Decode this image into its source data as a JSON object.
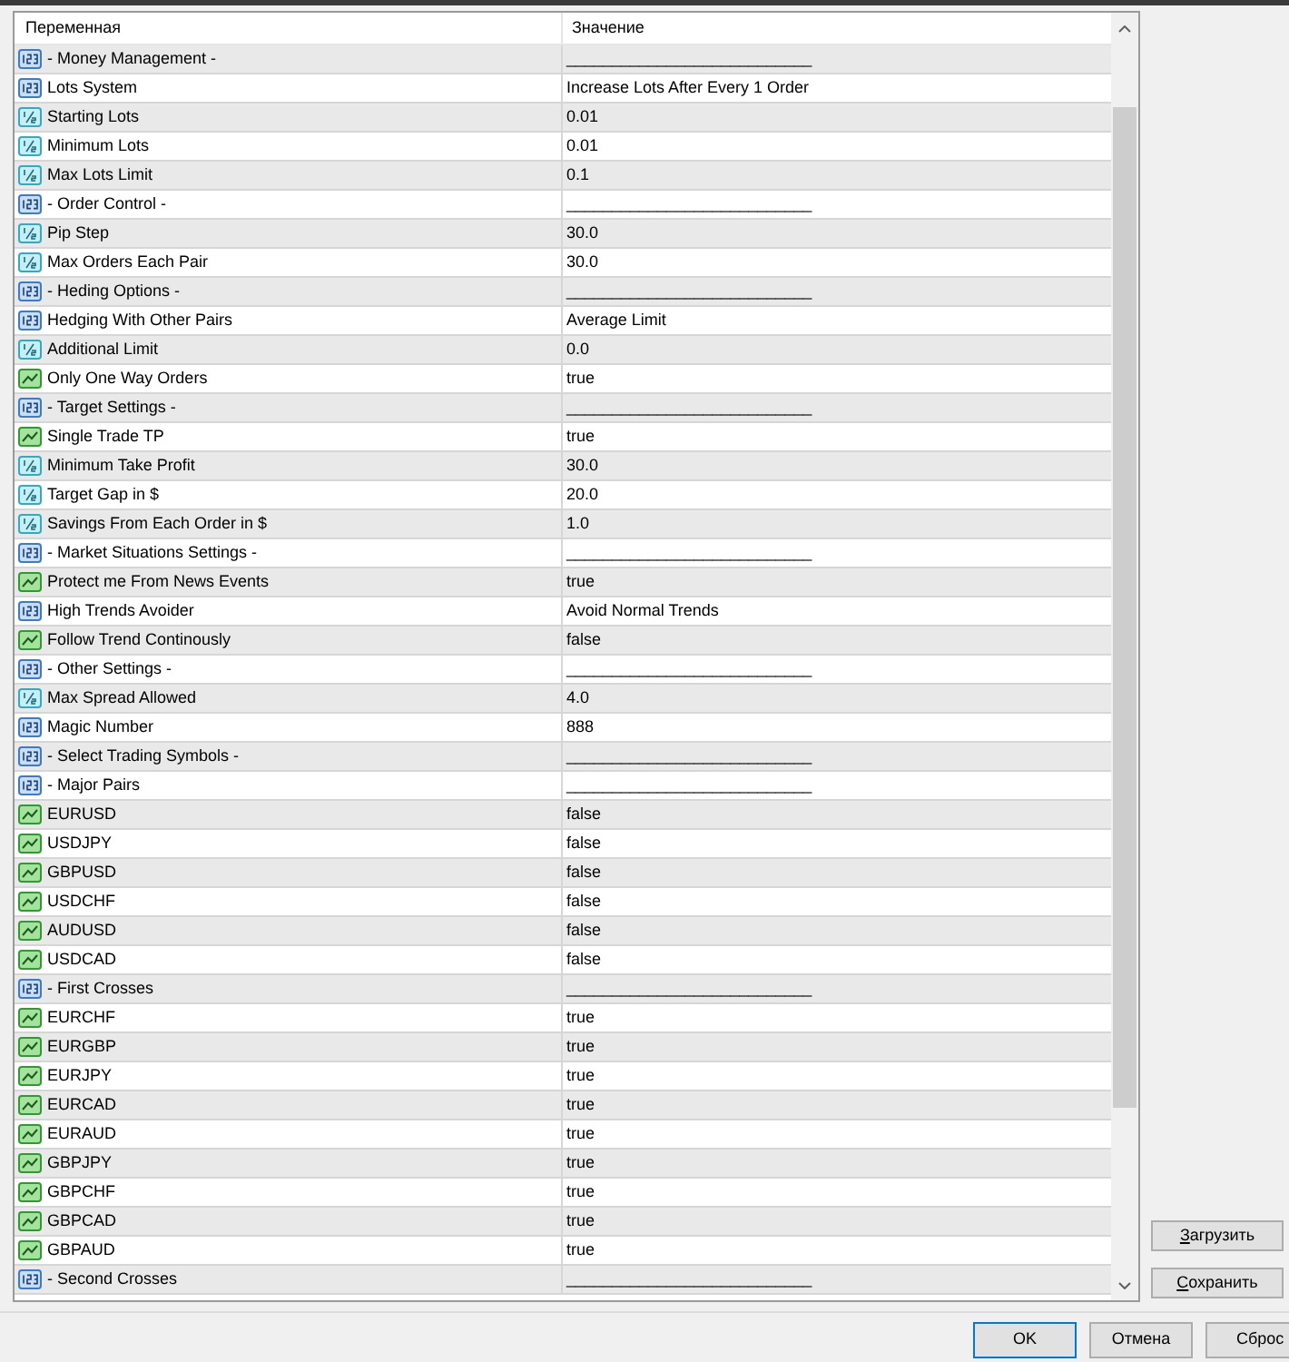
{
  "table": {
    "columns": [
      "Переменная",
      "Значение"
    ],
    "rows": [
      {
        "name": "- Money Management -",
        "value": "___________________________",
        "kind": "int"
      },
      {
        "name": "Lots System",
        "value": "Increase Lots After Every 1 Order",
        "kind": "int"
      },
      {
        "name": "Starting Lots",
        "value": "0.01",
        "kind": "double"
      },
      {
        "name": "Minimum Lots",
        "value": "0.01",
        "kind": "double"
      },
      {
        "name": "Max Lots Limit",
        "value": "0.1",
        "kind": "double"
      },
      {
        "name": "- Order Control -",
        "value": "___________________________",
        "kind": "int"
      },
      {
        "name": "Pip Step",
        "value": "30.0",
        "kind": "double"
      },
      {
        "name": "Max Orders Each Pair",
        "value": "30.0",
        "kind": "double"
      },
      {
        "name": "- Heding Options -",
        "value": "___________________________",
        "kind": "int"
      },
      {
        "name": "Hedging With Other Pairs",
        "value": "Average Limit",
        "kind": "int"
      },
      {
        "name": "Additional Limit",
        "value": "0.0",
        "kind": "double"
      },
      {
        "name": "Only One Way Orders",
        "value": "true",
        "kind": "bool"
      },
      {
        "name": "- Target Settings -",
        "value": "___________________________",
        "kind": "int"
      },
      {
        "name": "Single Trade TP",
        "value": "true",
        "kind": "bool"
      },
      {
        "name": "Minimum Take Profit",
        "value": "30.0",
        "kind": "double"
      },
      {
        "name": "Target Gap in $",
        "value": "20.0",
        "kind": "double"
      },
      {
        "name": "Savings From Each Order in $",
        "value": "1.0",
        "kind": "double"
      },
      {
        "name": "- Market Situations Settings -",
        "value": "___________________________",
        "kind": "int"
      },
      {
        "name": "Protect me From News Events",
        "value": "true",
        "kind": "bool"
      },
      {
        "name": "High Trends Avoider",
        "value": "Avoid Normal Trends",
        "kind": "int"
      },
      {
        "name": "Follow Trend Continously",
        "value": "false",
        "kind": "bool"
      },
      {
        "name": "- Other Settings -",
        "value": "___________________________",
        "kind": "int"
      },
      {
        "name": "Max Spread Allowed",
        "value": "4.0",
        "kind": "double"
      },
      {
        "name": "Magic Number",
        "value": "888",
        "kind": "int"
      },
      {
        "name": "- Select Trading Symbols -",
        "value": "___________________________",
        "kind": "int"
      },
      {
        "name": "- Major Pairs",
        "value": "___________________________",
        "kind": "int"
      },
      {
        "name": "EURUSD",
        "value": "false",
        "kind": "bool"
      },
      {
        "name": "USDJPY",
        "value": "false",
        "kind": "bool"
      },
      {
        "name": "GBPUSD",
        "value": "false",
        "kind": "bool"
      },
      {
        "name": "USDCHF",
        "value": "false",
        "kind": "bool"
      },
      {
        "name": "AUDUSD",
        "value": "false",
        "kind": "bool"
      },
      {
        "name": "USDCAD",
        "value": "false",
        "kind": "bool"
      },
      {
        "name": "- First Crosses",
        "value": "___________________________",
        "kind": "int"
      },
      {
        "name": "EURCHF",
        "value": "true",
        "kind": "bool"
      },
      {
        "name": "EURGBP",
        "value": "true",
        "kind": "bool"
      },
      {
        "name": "EURJPY",
        "value": "true",
        "kind": "bool"
      },
      {
        "name": "EURCAD",
        "value": "true",
        "kind": "bool"
      },
      {
        "name": "EURAUD",
        "value": "true",
        "kind": "bool"
      },
      {
        "name": "GBPJPY",
        "value": "true",
        "kind": "bool"
      },
      {
        "name": "GBPCHF",
        "value": "true",
        "kind": "bool"
      },
      {
        "name": "GBPCAD",
        "value": "true",
        "kind": "bool"
      },
      {
        "name": "GBPAUD",
        "value": "true",
        "kind": "bool"
      },
      {
        "name": "- Second Crosses",
        "value": "___________________________",
        "kind": "int"
      }
    ]
  },
  "side_buttons": [
    {
      "label": "Загрузить",
      "mnemonic": true
    },
    {
      "label": "Сохранить",
      "mnemonic": true
    }
  ],
  "dialog_buttons": [
    {
      "label": "OK",
      "default": true
    },
    {
      "label": "Отмена",
      "default": false
    },
    {
      "label": "Сброс",
      "default": false
    }
  ]
}
